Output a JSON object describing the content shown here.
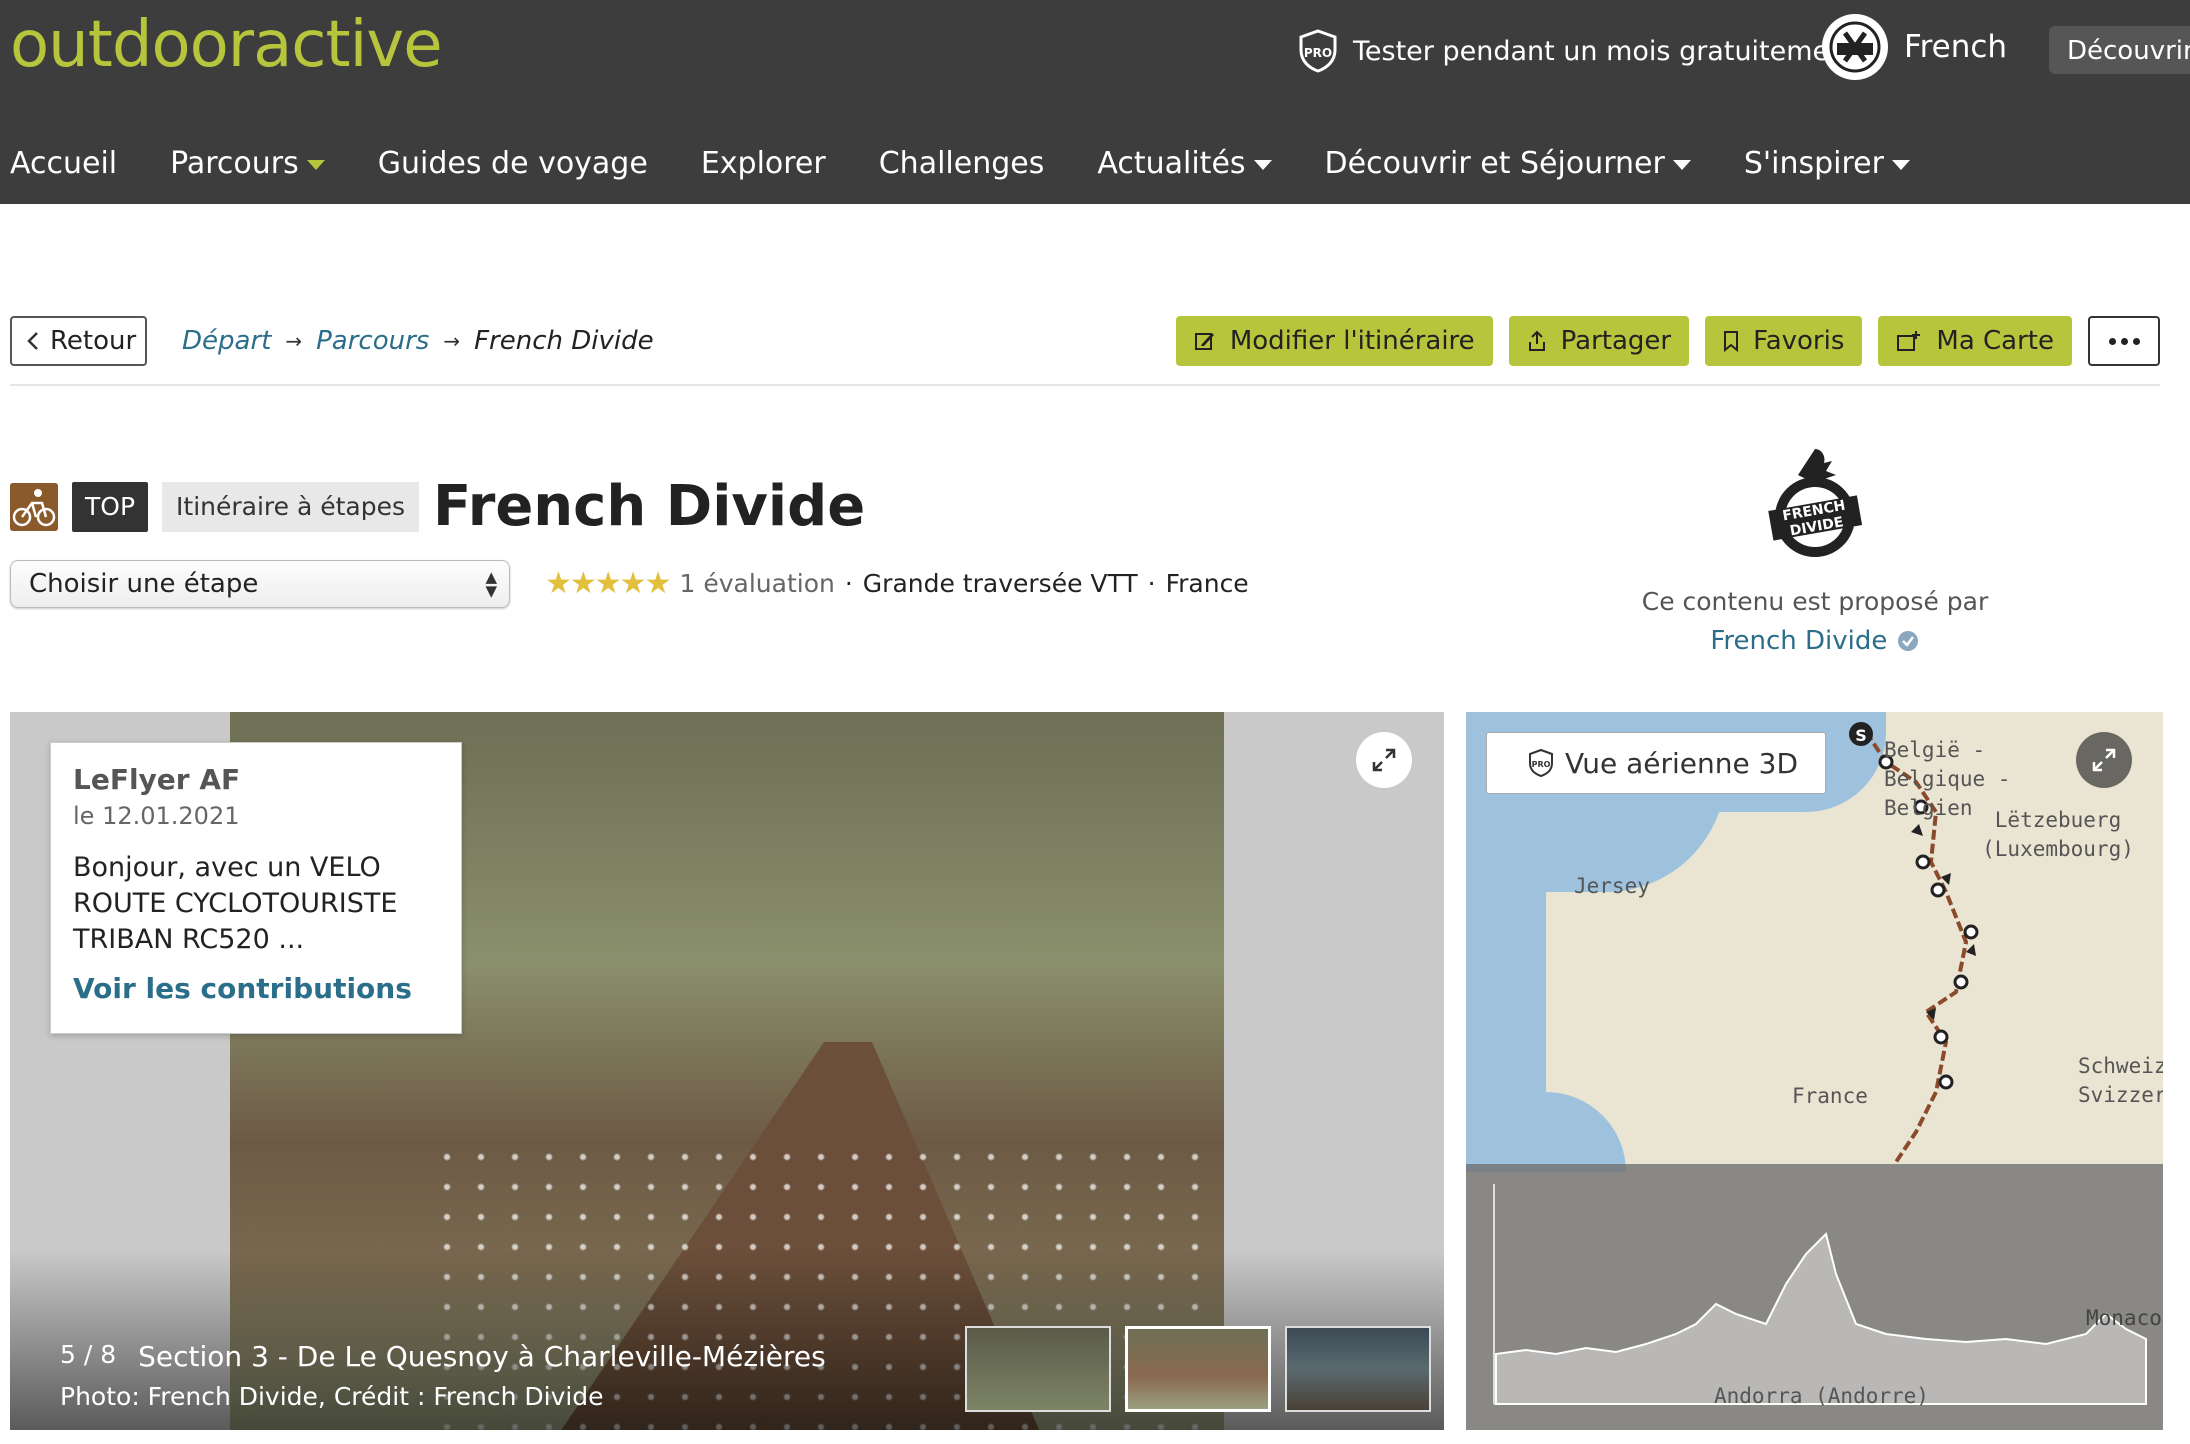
{
  "header": {
    "logo": "outdooractive",
    "trial_text": "Tester pendant un mois gratuitement",
    "language": "French",
    "discover_button": "Découvrir O"
  },
  "nav": {
    "items": [
      {
        "label": "Accueil",
        "dropdown": false
      },
      {
        "label": "Parcours",
        "dropdown": true
      },
      {
        "label": "Guides de voyage",
        "dropdown": false
      },
      {
        "label": "Explorer",
        "dropdown": false
      },
      {
        "label": "Challenges",
        "dropdown": false
      },
      {
        "label": "Actualités",
        "dropdown": true
      },
      {
        "label": "Découvrir et Séjourner",
        "dropdown": true
      },
      {
        "label": "S'inspirer",
        "dropdown": true
      }
    ]
  },
  "breadcrumb": {
    "back": "Retour",
    "items": [
      "Départ",
      "Parcours",
      "French Divide"
    ]
  },
  "actions": {
    "edit": "Modifier l'itinéraire",
    "share": "Partager",
    "favorites": "Favoris",
    "my_map": "Ma Carte"
  },
  "tour": {
    "badge_top": "TOP",
    "type": "Itinéraire à étapes",
    "title": "French Divide",
    "stage_select": "Choisir une étape",
    "stars": "★★★★★",
    "rating_count": "1 évaluation",
    "category": "Grande traversée VTT",
    "country": "France"
  },
  "provider": {
    "label": "Ce contenu est proposé par",
    "name": "French Divide",
    "logo_text": [
      "FRENCH",
      "DIVIDE"
    ]
  },
  "comment": {
    "author": "LeFlyer AF",
    "date": "le 12.01.2021",
    "text": "Bonjour, avec un VELO ROUTE CYCLOTOURISTE TRIBAN RC520 ...",
    "link": "Voir les contributions"
  },
  "gallery": {
    "page": "5 / 8",
    "caption": "Section 3 - De Le Quesnoy à Charleville-Mézières",
    "credit": "Photo: French Divide, Crédit : French Divide"
  },
  "map": {
    "aerial_button": "Vue aérienne 3D",
    "labels": {
      "belgium": "België - Belgique - Belgien",
      "luxembourg": "Lëtzebuerg (Luxembourg)",
      "jersey": "Jersey",
      "france": "France",
      "switzerland": "Schweiz Svizzer",
      "monaco": "Monaco",
      "andorra": "Andorra (Andorre)"
    },
    "start_marker": "S"
  },
  "colors": {
    "accent": "#b6c53b",
    "header_bg": "#3d3d3d",
    "link": "#2b6e8a",
    "star": "#e2bf3c",
    "route": "#8b4a2b"
  }
}
